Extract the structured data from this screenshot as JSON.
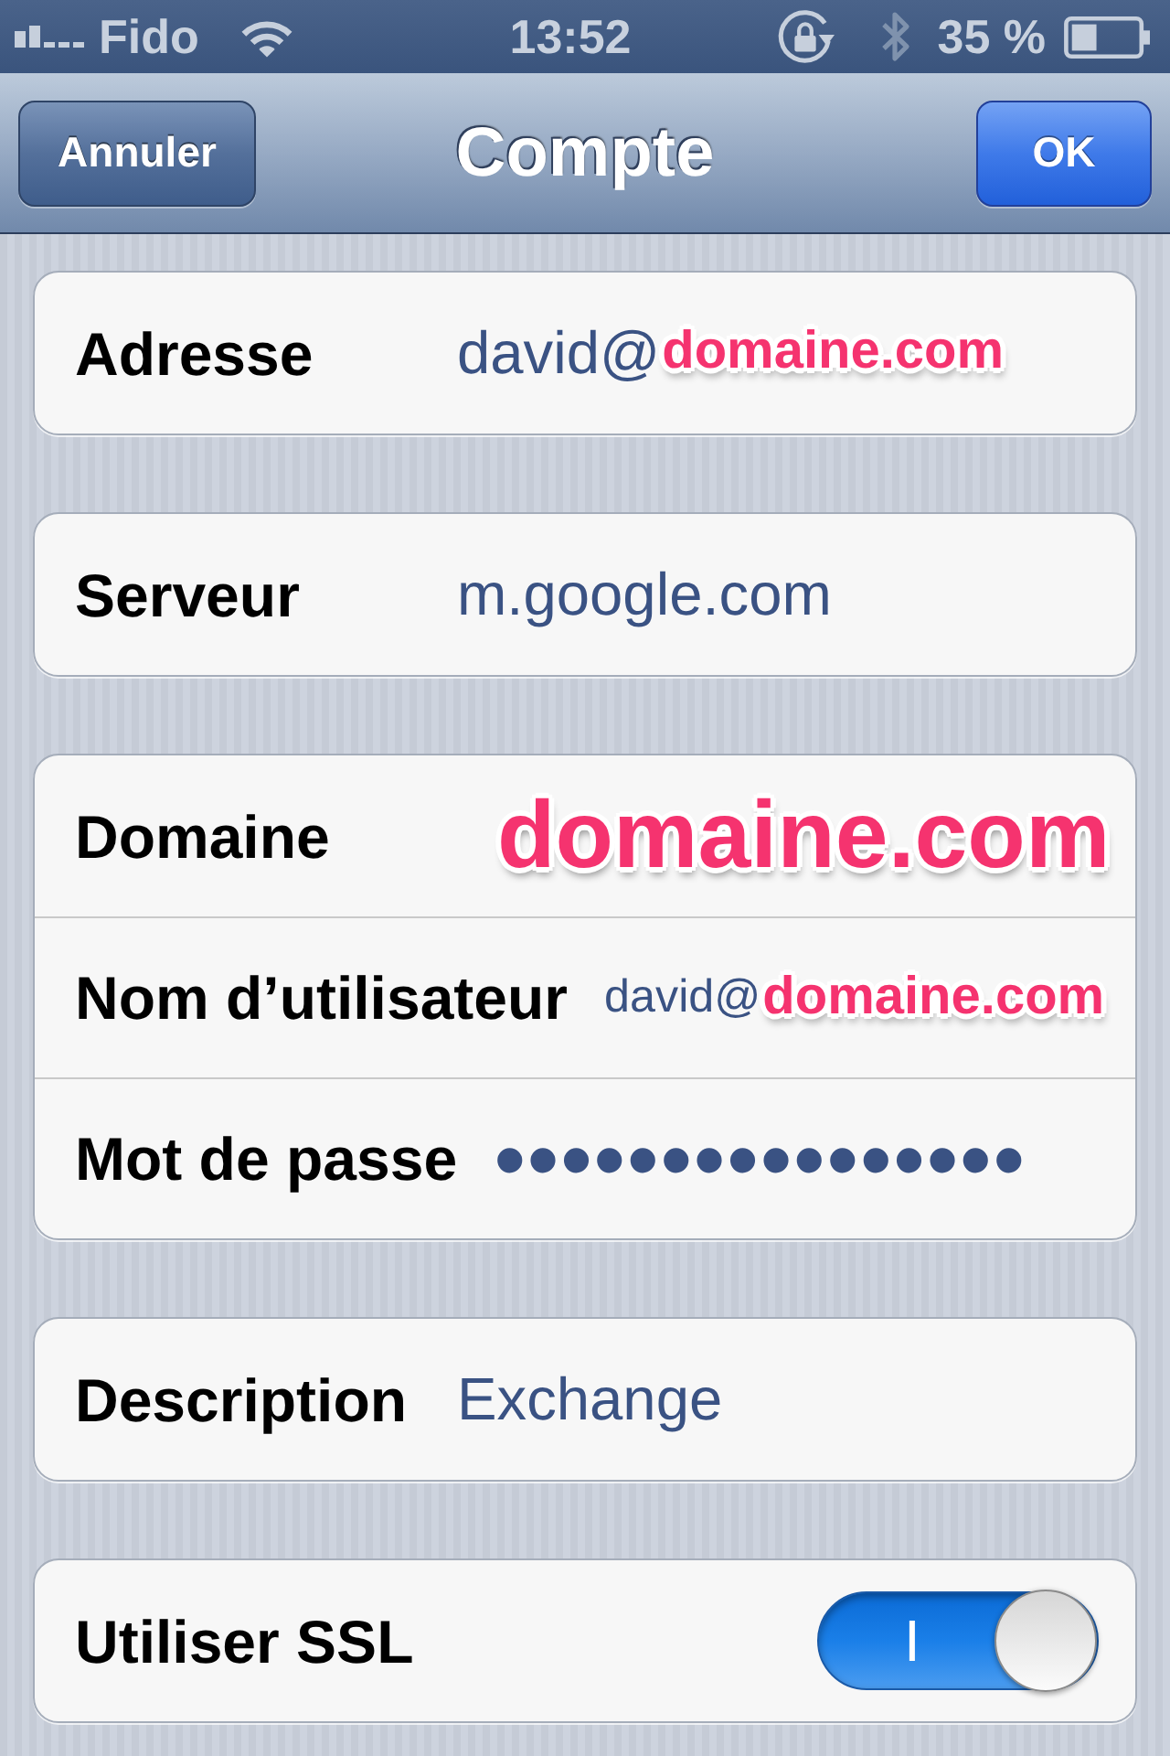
{
  "status_bar": {
    "carrier": "Fido",
    "time": "13:52",
    "battery": "35 %"
  },
  "nav_bar": {
    "cancel": "Annuler",
    "title": "Compte",
    "done": "OK"
  },
  "groups": [
    {
      "rows": [
        {
          "kind": "text",
          "label": "Adresse",
          "value": "david@",
          "overlay": "domaine.com"
        }
      ]
    },
    {
      "rows": [
        {
          "kind": "text",
          "label": "Serveur",
          "value": "m.google.com"
        }
      ]
    },
    {
      "rows": [
        {
          "kind": "text",
          "label": "Domaine",
          "overlay": "domaine.com"
        },
        {
          "kind": "text",
          "label": "Nom d’utilisateur",
          "value": "david@",
          "overlay": "domaine.com"
        },
        {
          "kind": "password",
          "label": "Mot de passe",
          "value": "••••••••••••••••"
        }
      ]
    },
    {
      "rows": [
        {
          "kind": "text",
          "label": "Description",
          "value": "Exchange"
        }
      ]
    },
    {
      "rows": [
        {
          "kind": "switch",
          "label": "Utiliser SSL",
          "on": true,
          "on_label": "I"
        }
      ]
    }
  ]
}
